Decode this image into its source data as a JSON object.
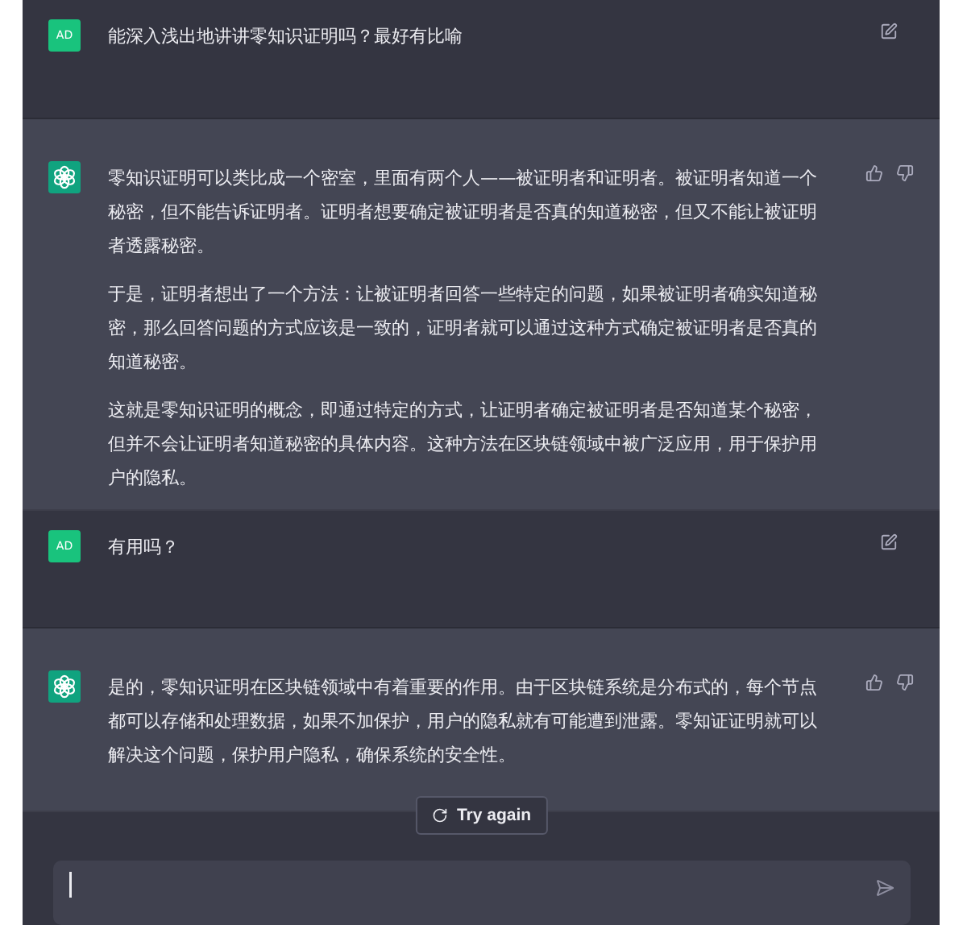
{
  "messages": [
    {
      "kind": "user",
      "avatar": "AD",
      "paragraphs": [
        "能深入浅出地讲讲零知识证明吗？最好有比喻"
      ]
    },
    {
      "kind": "assistant",
      "paragraphs": [
        "零知识证明可以类比成一个密室，里面有两个人——被证明者和证明者。被证明者知道一个秘密，但不能告诉证明者。证明者想要确定被证明者是否真的知道秘密，但又不能让被证明者透露秘密。",
        "于是，证明者想出了一个方法：让被证明者回答一些特定的问题，如果被证明者确实知道秘密，那么回答问题的方式应该是一致的，证明者就可以通过这种方式确定被证明者是否真的知道秘密。",
        "这就是零知识证明的概念，即通过特定的方式，让证明者确定被证明者是否知道某个秘密，但并不会让证明者知道秘密的具体内容。这种方法在区块链领域中被广泛应用，用于保护用户的隐私。"
      ]
    },
    {
      "kind": "user",
      "avatar": "AD",
      "paragraphs": [
        "有用吗？"
      ]
    },
    {
      "kind": "assistant",
      "paragraphs": [
        "是的，零知识证明在区块链领域中有着重要的作用。由于区块链系统是分布式的，每个节点都可以存储和处理数据，如果不加保护，用户的隐私就有可能遭到泄露。零知证证明就可以解决这个问题，保护用户隐私，确保系统的安全性。"
      ]
    }
  ],
  "retry_button": "Try again"
}
